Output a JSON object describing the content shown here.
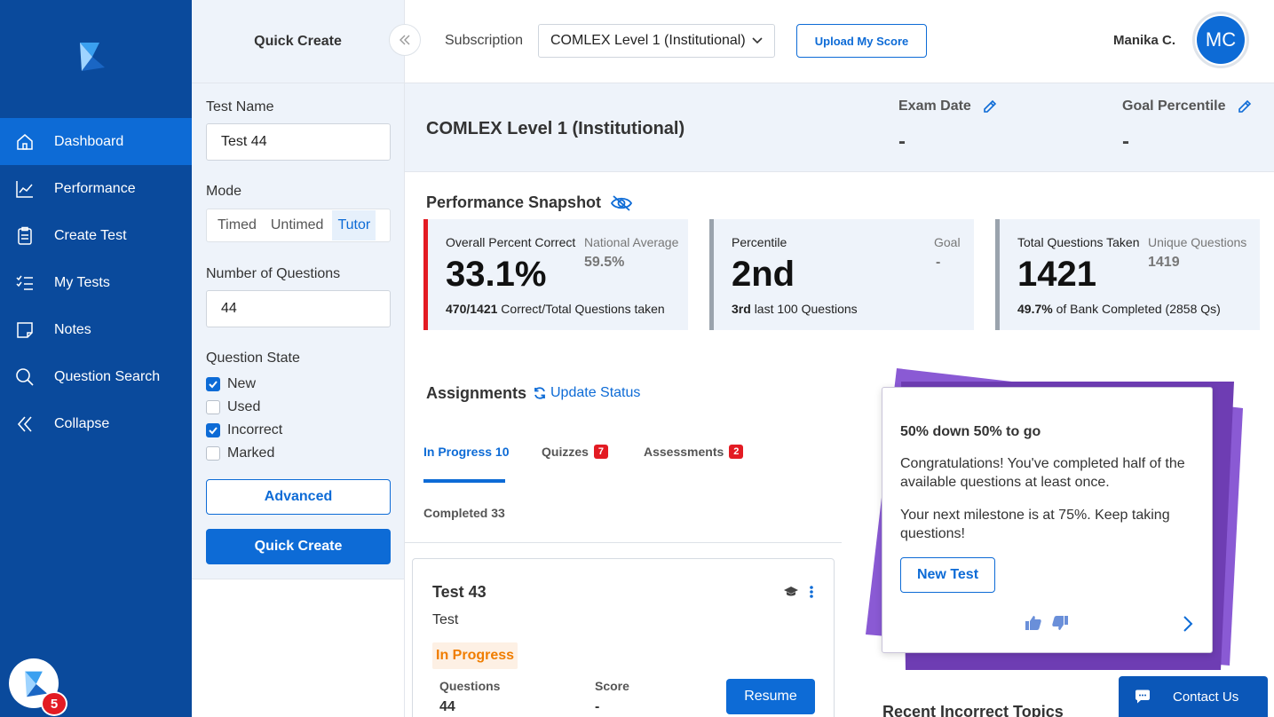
{
  "nav": {
    "items": [
      {
        "label": "Dashboard",
        "icon": "home-icon"
      },
      {
        "label": "Performance",
        "icon": "chart-line-icon"
      },
      {
        "label": "Create Test",
        "icon": "clipboard-icon"
      },
      {
        "label": "My Tests",
        "icon": "list-check-icon"
      },
      {
        "label": "Notes",
        "icon": "note-icon"
      },
      {
        "label": "Question Search",
        "icon": "search-icon"
      },
      {
        "label": "Collapse",
        "icon": "double-chevron-left-icon"
      }
    ],
    "notification_count": "5"
  },
  "quick_create": {
    "title": "Quick Create",
    "test_name_label": "Test Name",
    "test_name_value": "Test 44",
    "mode_label": "Mode",
    "modes": [
      "Timed",
      "Untimed",
      "Tutor"
    ],
    "num_questions_label": "Number of Questions",
    "num_questions_value": "44",
    "question_state_label": "Question State",
    "states": [
      {
        "label": "New",
        "checked": true
      },
      {
        "label": "Used",
        "checked": false
      },
      {
        "label": "Incorrect",
        "checked": true
      },
      {
        "label": "Marked",
        "checked": false
      }
    ],
    "advanced_label": "Advanced",
    "create_label": "Quick Create"
  },
  "topbar": {
    "subscription_label": "Subscription",
    "subscription_value": "COMLEX Level 1 (Institutional)",
    "upload_label": "Upload My Score",
    "user_name": "Manika C.",
    "avatar_initials": "MC"
  },
  "exam": {
    "title": "COMLEX Level 1 (Institutional)",
    "exam_date_label": "Exam Date",
    "exam_date_value": "-",
    "goal_label": "Goal Percentile",
    "goal_value": "-"
  },
  "snapshot": {
    "title": "Performance Snapshot",
    "cards": [
      {
        "label": "Overall Percent Correct",
        "side_label": "National Average",
        "side_value": "59.5%",
        "big": "33.1%",
        "foot_bold": "470/1421",
        "foot": "Correct/Total Questions taken"
      },
      {
        "label": "Percentile",
        "side_label": "Goal",
        "side_value": "-",
        "big": "2nd",
        "foot_bold": "3rd",
        "foot": "last 100 Questions"
      },
      {
        "label": "Total Questions Taken",
        "side_label": "Unique Questions",
        "side_value": "1419",
        "big": "1421",
        "foot_bold": "49.7%",
        "foot": "of Bank Completed (2858 Qs)"
      }
    ]
  },
  "assignments": {
    "title": "Assignments",
    "update_label": "Update Status",
    "tabs": [
      {
        "label": "In Progress 10"
      },
      {
        "label": "Quizzes",
        "badge": "7"
      },
      {
        "label": "Assessments",
        "badge": "2"
      },
      {
        "label": "Completed 33"
      }
    ]
  },
  "test_card": {
    "title": "Test 43",
    "subtitle": "Test",
    "status": "In Progress",
    "questions_label": "Questions",
    "questions_value": "44",
    "score_label": "Score",
    "score_value": "-",
    "resume_label": "Resume"
  },
  "milestone": {
    "title": "50% down 50% to go",
    "p1": "Congratulations! You've completed half of the available questions at least once.",
    "p2": "Your next milestone is at 75%. Keep taking questions!",
    "button": "New Test"
  },
  "recent_title": "Recent Incorrect Topics",
  "contact_label": "Contact Us",
  "colors": {
    "primary": "#0d6bd6",
    "sidebar": "#0a4a9c",
    "danger": "#e31b23",
    "warning": "#f07d00",
    "purple": "#7b4bc4"
  }
}
